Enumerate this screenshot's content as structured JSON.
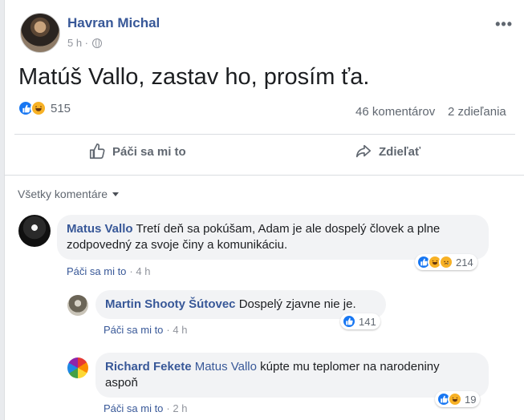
{
  "post": {
    "author": "Havran Michal",
    "time": "5 h ·",
    "text": "Matúš Vallo, zastav ho, prosím ťa.",
    "reactions_count": "515",
    "comments_count": "46 komentárov",
    "shares_count": "2 zdieľania",
    "more_label": "•••"
  },
  "actions": {
    "like_label": "Páči sa mi to",
    "share_label": "Zdieľať"
  },
  "comments_filter": {
    "label": "Všetky komentáre"
  },
  "comments": [
    {
      "author": "Matus Vallo",
      "text": "Tretí deň sa pokúšam, Adam je ale dospelý človek a plne",
      "text2": "zodpovedný za svoje činy a komunikáciu.",
      "like_label": "Páči sa mi to",
      "time": "· 4 h",
      "reactions_count": "214"
    },
    {
      "author": "Martin Shooty Šútovec",
      "text": "Dospelý zjavne nie je.",
      "like_label": "Páči sa mi to",
      "time": "· 4 h",
      "reactions_count": "141"
    },
    {
      "author": "Richard Fekete",
      "mention": "Matus Vallo",
      "text": "kúpte mu teplomer na narodeniny",
      "text2": "aspoň",
      "like_label": "Páči sa mi to",
      "time": "· 2 h",
      "reactions_count": "19"
    }
  ],
  "icons": {
    "like": "thumbs-up-icon",
    "haha": "haha-face-icon",
    "sad": "sad-face-icon",
    "share": "share-arrow-icon",
    "globe": "globe-icon"
  },
  "colors": {
    "link": "#385898",
    "like_blue": "#1877f2",
    "bubble_bg": "#f2f3f5"
  }
}
